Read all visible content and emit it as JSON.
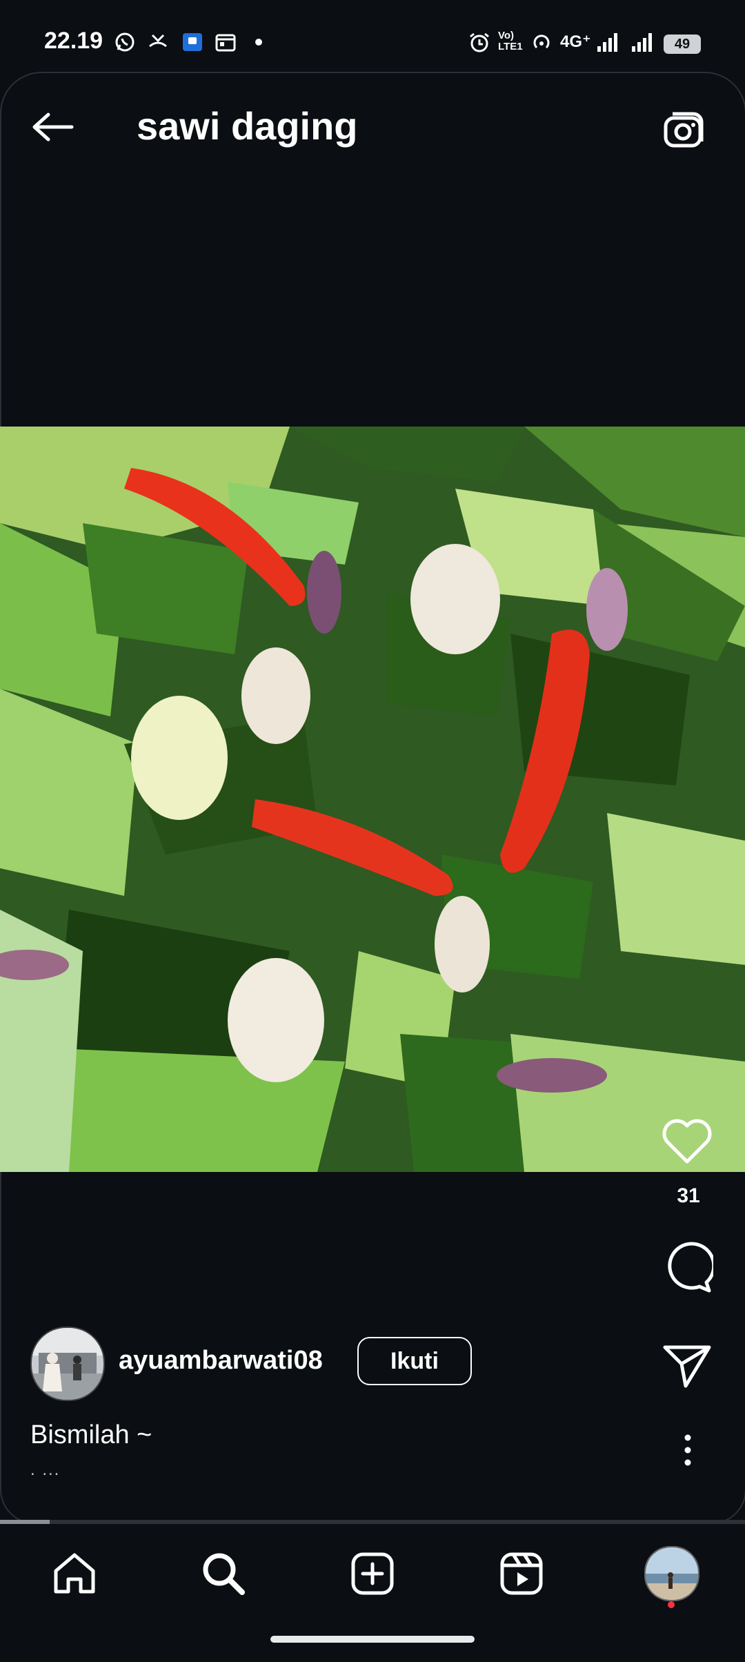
{
  "status_bar": {
    "time": "22.19",
    "network_label": "4G⁺",
    "volte_label": "Vo) LTE1",
    "battery": "49",
    "icons": [
      "whatsapp-icon",
      "missed-call-icon",
      "app-notification-icon",
      "calendar-icon",
      "dot-icon",
      "alarm-icon",
      "volte-icon",
      "hotspot-icon",
      "signal-icon",
      "signal-icon"
    ]
  },
  "header": {
    "title": "sawi daging",
    "back_icon": "arrow-left-icon",
    "camera_icon": "camera-icon"
  },
  "post": {
    "image_subject": "sautéed mustard greens with red chili and shallots",
    "like_count": "31",
    "username": "ayuambarwati08",
    "follow_label": "Ikuti",
    "caption": "Bismilah ~",
    "caption_more": ". ...",
    "progress": 0.067
  },
  "actions": [
    "heart-icon",
    "comment-icon",
    "share-icon",
    "more-vertical-icon"
  ],
  "bottom_nav": [
    "home-icon",
    "search-icon",
    "create-icon",
    "reels-icon",
    "profile-avatar"
  ],
  "colors": {
    "background": "#0b0e12",
    "chili": "#e8321c",
    "greens": "#3f7a2c"
  }
}
